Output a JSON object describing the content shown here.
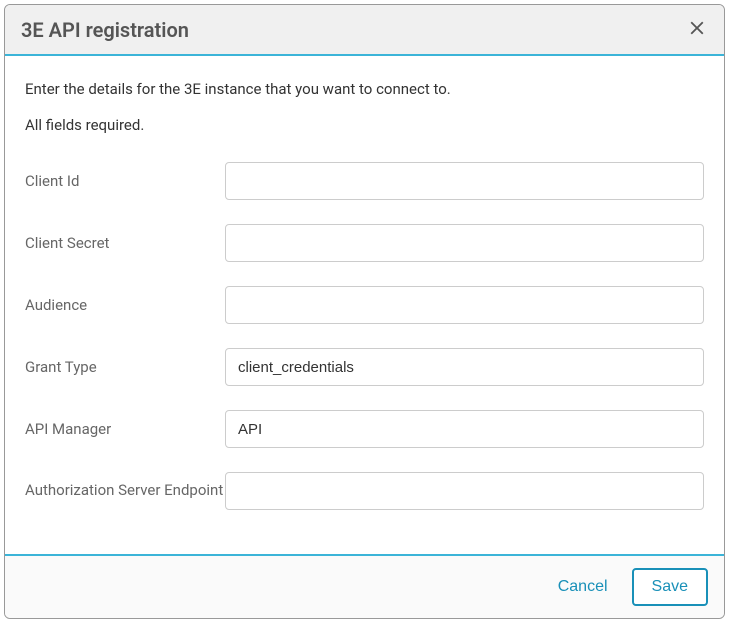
{
  "dialog": {
    "title": "3E API registration",
    "intro": "Enter the details for the 3E instance that you want to connect to.",
    "required": "All fields required."
  },
  "fields": {
    "client_id": {
      "label": "Client Id",
      "value": ""
    },
    "client_secret": {
      "label": "Client Secret",
      "value": ""
    },
    "audience": {
      "label": "Audience",
      "value": ""
    },
    "grant_type": {
      "label": "Grant Type",
      "value": "client_credentials"
    },
    "api_manager": {
      "label": "API Manager",
      "value": "API"
    },
    "auth_endpoint": {
      "label": "Authorization Server Endpoint",
      "value": ""
    }
  },
  "buttons": {
    "cancel": "Cancel",
    "save": "Save"
  }
}
